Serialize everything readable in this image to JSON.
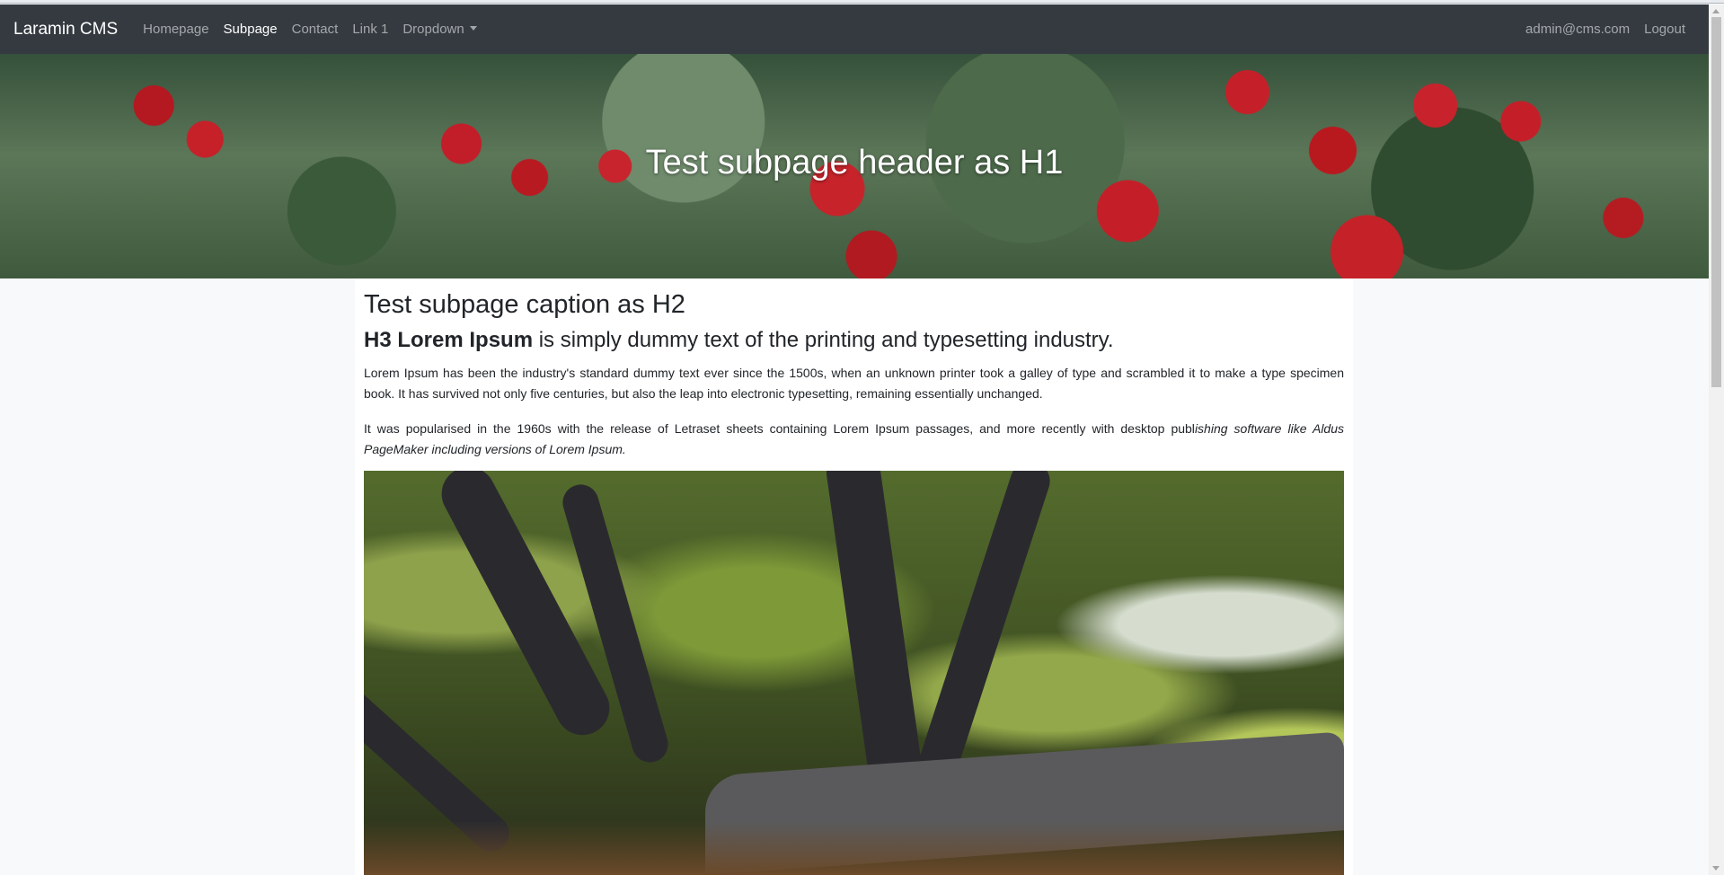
{
  "navbar": {
    "brand": "Laramin CMS",
    "links": [
      "Homepage",
      "Subpage",
      "Contact",
      "Link 1"
    ],
    "dropdown": "Dropdown",
    "active": "Subpage",
    "user": "admin@cms.com",
    "logout": "Logout"
  },
  "hero": {
    "title": "Test subpage header as H1"
  },
  "content": {
    "h2": "Test subpage caption as H2",
    "h3_bold": "H3 Lorem Ipsum",
    "h3_rest": " is simply dummy text of the printing and typesetting industry.",
    "p1": "Lorem Ipsum has been the industry's standard dummy text ever since the 1500s, when an unknown printer took a galley of type and scrambled it to make a type specimen book. It has survived not only five centuries, but also the leap into electronic typesetting, remaining essentially unchanged.",
    "p2_normal": "It was popularised in the 1960s with the release of Letraset sheets containing Lorem Ipsum passages, and more recently with desktop publ",
    "p2_italic": "ishing software like Aldus PageMaker including versions of Lorem Ipsum."
  }
}
